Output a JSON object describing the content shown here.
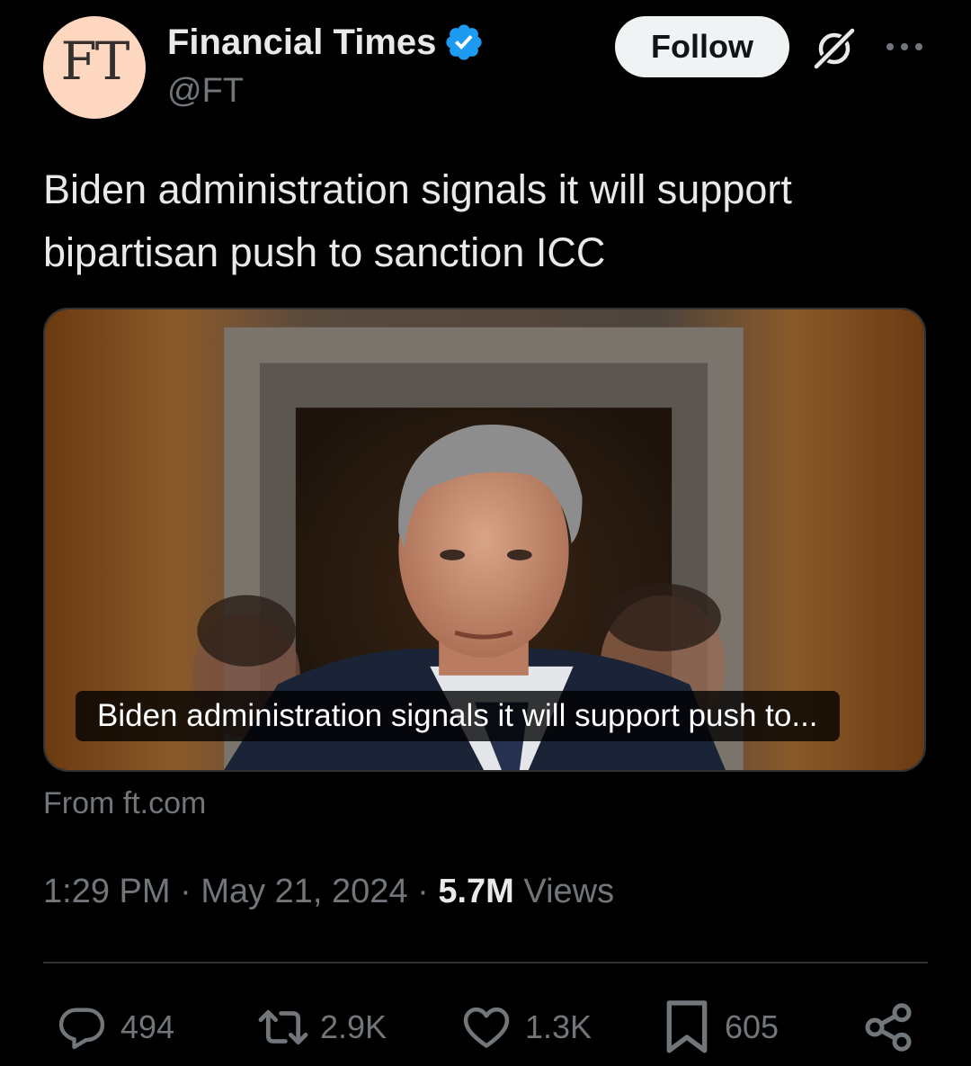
{
  "author": {
    "display_name": "Financial Times",
    "handle": "@FT",
    "avatar_text": "FT",
    "verified": true
  },
  "header": {
    "follow_label": "Follow",
    "grok_icon": "grok-icon",
    "more_icon": "more-icon"
  },
  "tweet": {
    "text": "Biden administration signals it will support bipartisan push to sanction ICC"
  },
  "card": {
    "caption": "Biden administration signals it will support push to...",
    "source": "From ft.com"
  },
  "meta": {
    "time": "1:29 PM",
    "separator": "·",
    "date": "May 21, 2024",
    "views_count": "5.7M",
    "views_label": "Views"
  },
  "actions": {
    "replies": "494",
    "reposts": "2.9K",
    "likes": "1.3K",
    "bookmarks": "605"
  },
  "colors": {
    "background": "#000000",
    "text_primary": "#e7e9ea",
    "text_secondary": "#71767b",
    "verified_blue": "#1d9bf0",
    "avatar_bg": "#fdd7bf",
    "divider": "#2f3336"
  }
}
